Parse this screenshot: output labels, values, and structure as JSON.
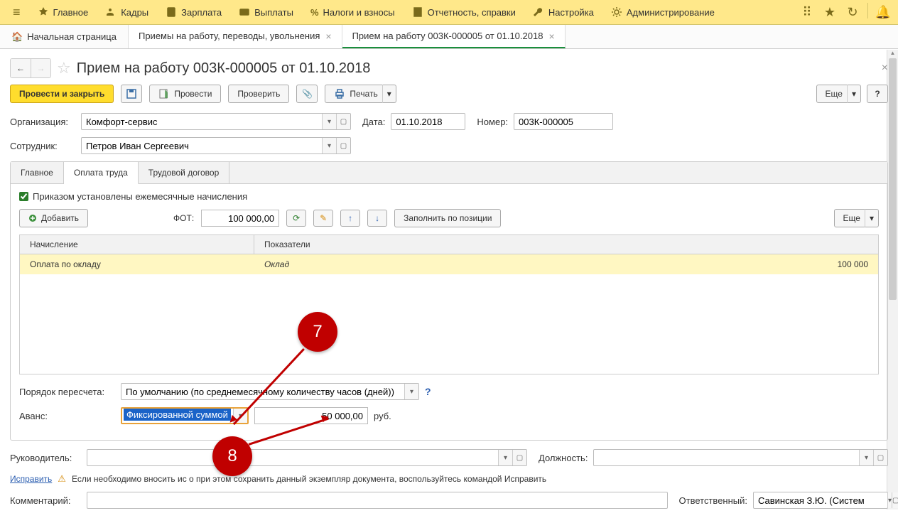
{
  "menu": {
    "items": [
      "Главное",
      "Кадры",
      "Зарплата",
      "Выплаты",
      "Налоги и взносы",
      "Отчетность, справки",
      "Настройка",
      "Администрирование"
    ]
  },
  "tabs": {
    "home": "Начальная страница",
    "t1": "Приемы на работу, переводы, увольнения",
    "t2": "Прием на работу 003К-000005 от 01.10.2018"
  },
  "doc": {
    "title": "Прием на работу 003К-000005 от 01.10.2018"
  },
  "toolbar": {
    "primary": "Провести и закрыть",
    "provesti": "Провести",
    "check": "Проверить",
    "print": "Печать",
    "more": "Еще"
  },
  "fields": {
    "org_label": "Организация:",
    "org_value": "Комфорт-сервис",
    "date_label": "Дата:",
    "date_value": "01.10.2018",
    "number_label": "Номер:",
    "number_value": "003К-000005",
    "emp_label": "Сотрудник:",
    "emp_value": "Петров Иван Сергеевич"
  },
  "innertabs": {
    "t1": "Главное",
    "t2": "Оплата труда",
    "t3": "Трудовой договор"
  },
  "panel": {
    "checkbox": "Приказом установлены ежемесячные начисления",
    "add": "Добавить",
    "fot_label": "ФОТ:",
    "fot_value": "100 000,00",
    "fill_pos": "Заполнить по позиции",
    "more": "Еще"
  },
  "table": {
    "col1": "Начисление",
    "col2": "Показатели",
    "row1_name": "Оплата по окладу",
    "row1_param": "Оклад",
    "row1_amount": "100 000"
  },
  "after": {
    "recalc_label": "Порядок пересчета:",
    "recalc_value": "По умолчанию (по среднемесячному количеству часов (дней))",
    "avans_label": "Аванс:",
    "avans_mode": "Фиксированной суммой",
    "avans_value": "50 000,00",
    "avans_unit": "руб.",
    "ruk_label": "Руководитель:",
    "dol_label": "Должность:",
    "correct_link": "Исправить",
    "correct_text": "Если необходимо вносить ис                   о при этом сохранить данный экземпляр документа, воспользуйтесь командой Исправить",
    "comment_label": "Комментарий:",
    "resp_label": "Ответственный:",
    "resp_value": "Савинская З.Ю. (Систем"
  },
  "annot": {
    "n7": "7",
    "n8": "8"
  }
}
